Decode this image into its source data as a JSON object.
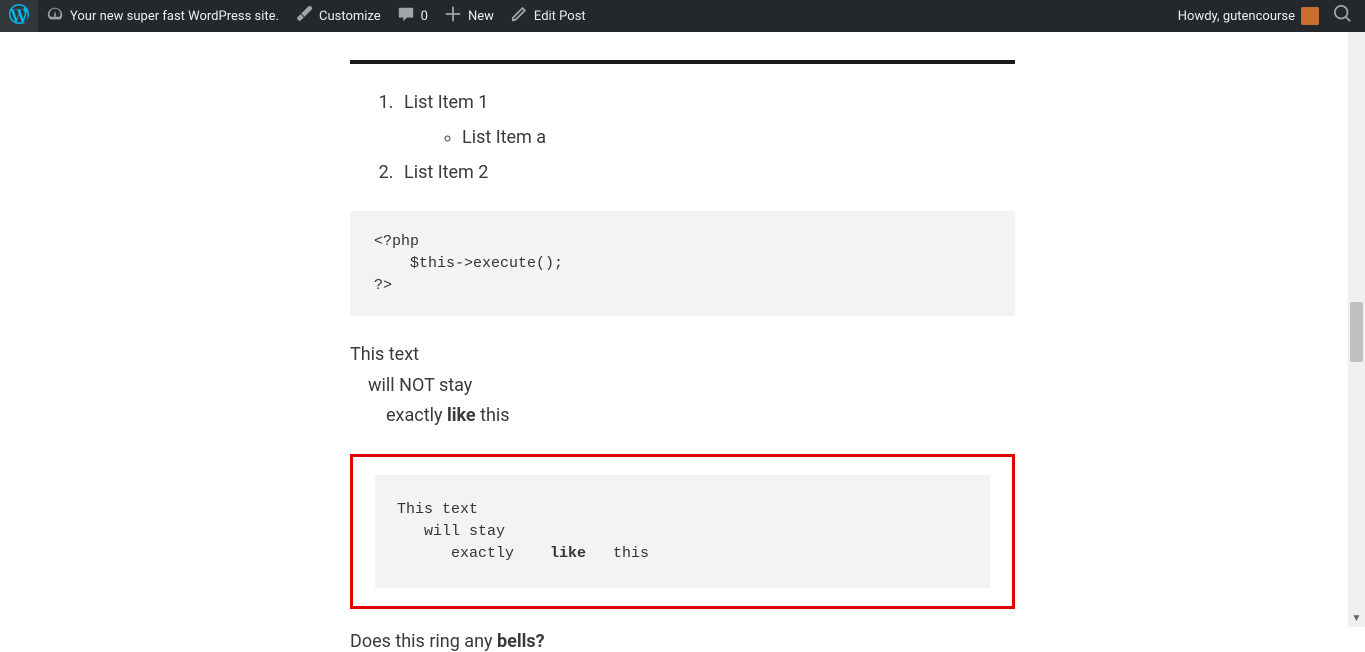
{
  "adminbar": {
    "site_name": "Your new super fast WordPress site.",
    "customize": "Customize",
    "comments_count": "0",
    "new": "New",
    "edit_post": "Edit Post",
    "howdy_prefix": "Howdy, ",
    "username": "gutencourse"
  },
  "content": {
    "list_item_1": "List Item 1",
    "list_item_a": "List Item a",
    "list_item_2": "List Item 2",
    "code_block": "<?php\n    $this->execute();\n?>",
    "para_line1": "This text",
    "para_line2": "will NOT stay",
    "para_line3_a": "exactly    ",
    "para_line3_bold": "like",
    "para_line3_b": " this",
    "pre_line1": "This text",
    "pre_line2": "   will stay",
    "pre_line3_a": "      exactly    ",
    "pre_line3_bold": "like",
    "pre_line3_b": "   this",
    "closing_a": "Does this ring any ",
    "closing_bold": "bells?"
  }
}
